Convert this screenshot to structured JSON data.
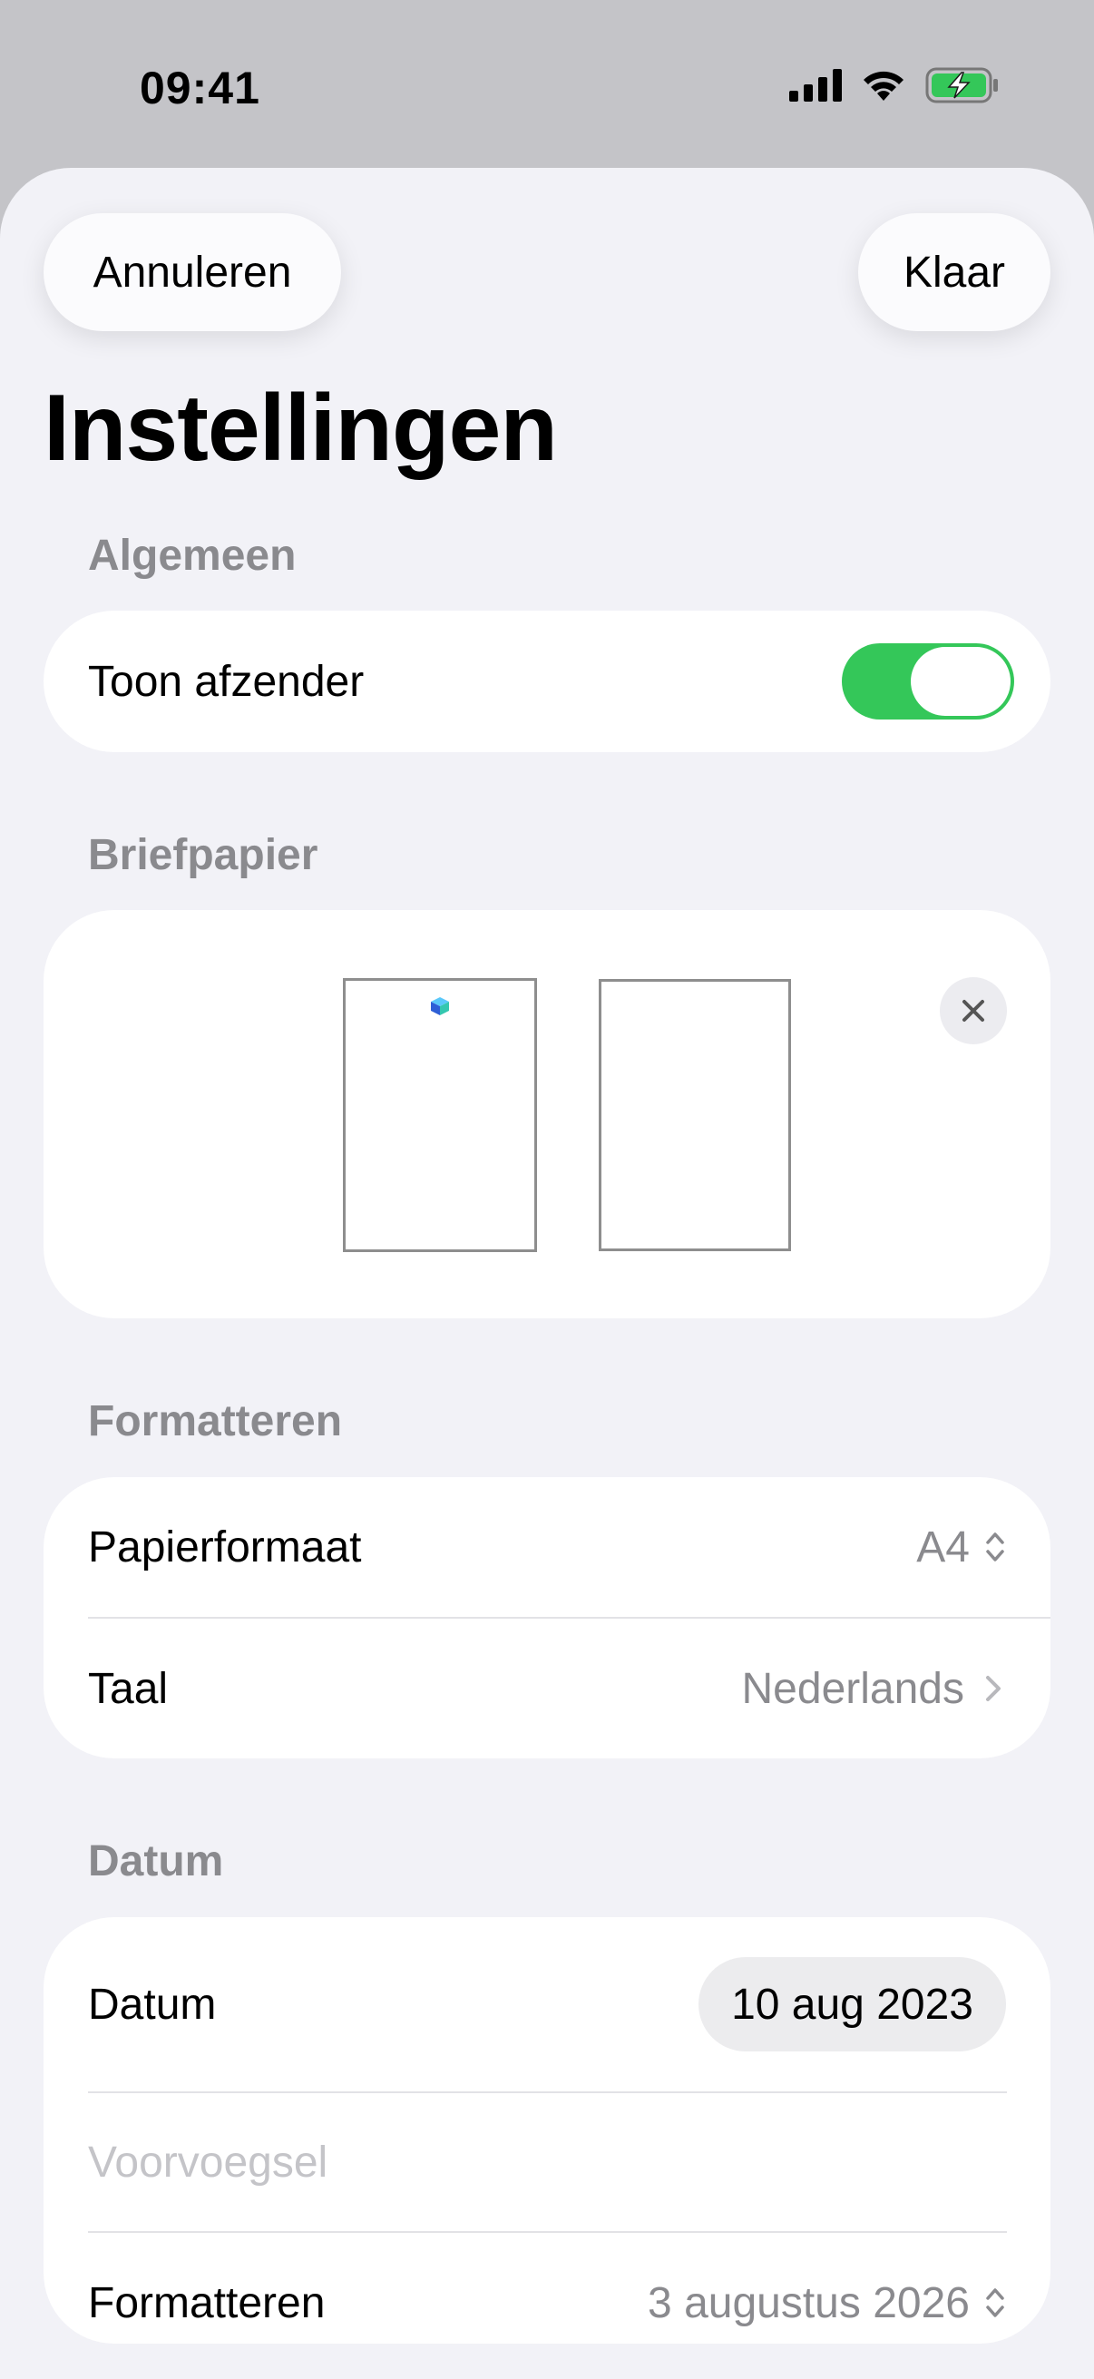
{
  "status_bar": {
    "time": "09:41"
  },
  "header": {
    "cancel_label": "Annuleren",
    "done_label": "Klaar",
    "title": "Instellingen"
  },
  "sections": {
    "general": {
      "header": "Algemeen",
      "show_sender": {
        "label": "Toon afzender",
        "enabled": true
      }
    },
    "stationery": {
      "header": "Briefpapier"
    },
    "formatting": {
      "header": "Formatteren",
      "paper_size": {
        "label": "Papierformaat",
        "value": "A4"
      },
      "language": {
        "label": "Taal",
        "value": "Nederlands"
      }
    },
    "date": {
      "header": "Datum",
      "date_row": {
        "label": "Datum",
        "value": "10 aug 2023"
      },
      "prefix_placeholder": "Voorvoegsel",
      "format_row": {
        "label": "Formatteren",
        "value": "3 augustus 2026"
      }
    }
  },
  "colors": {
    "accent_green": "#34c759",
    "secondary_text": "#8a8a8e",
    "background": "#f2f2f7"
  }
}
